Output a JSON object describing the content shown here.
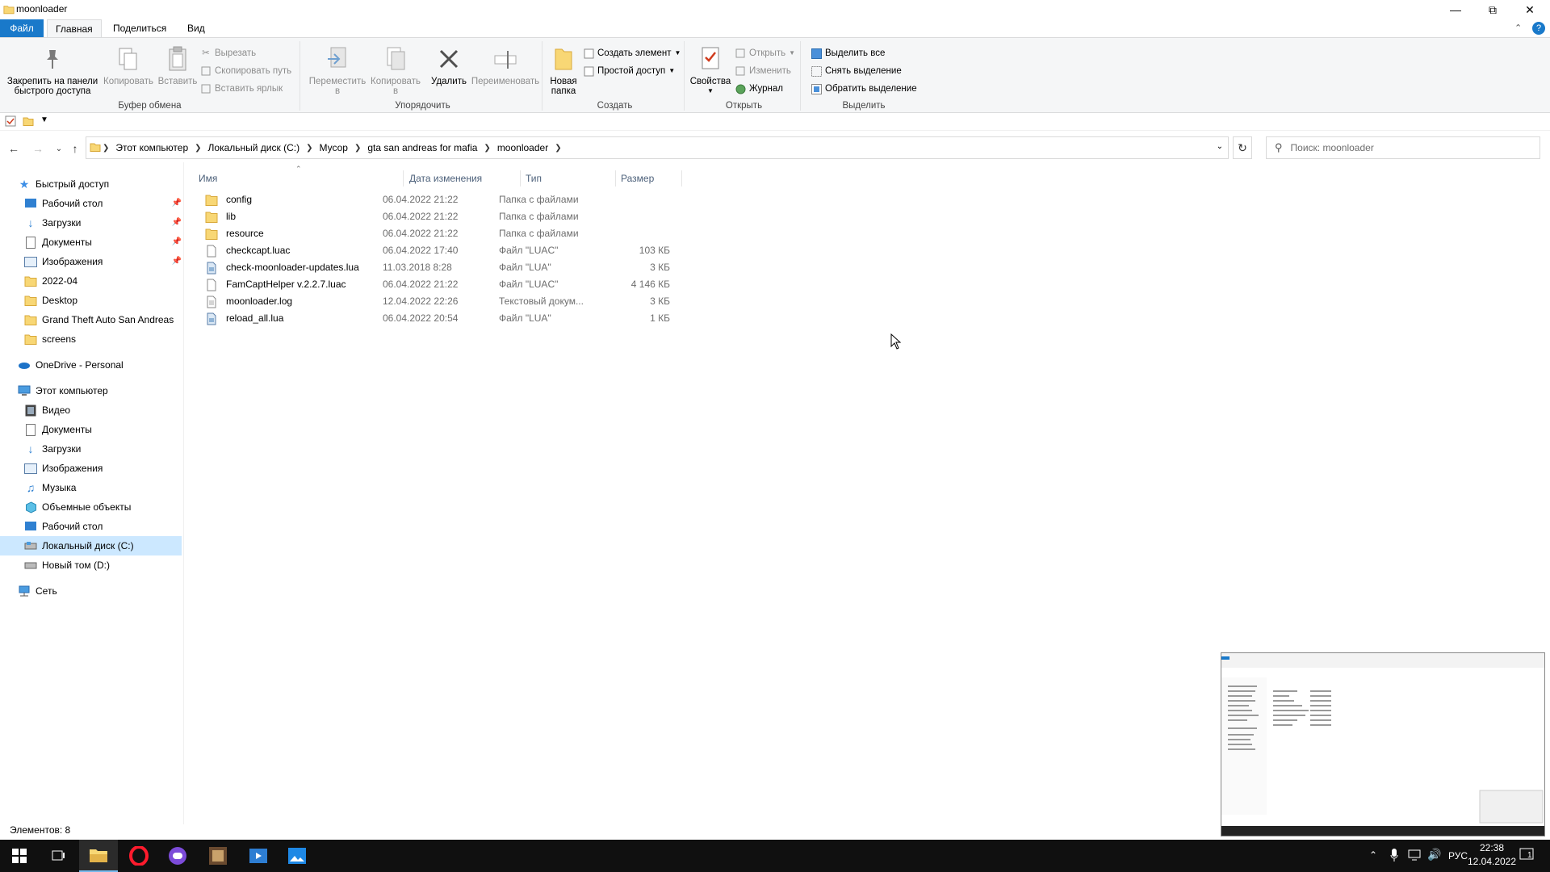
{
  "window": {
    "title": "moonloader"
  },
  "ribbon_tabs": [
    "Файл",
    "Главная",
    "Поделиться",
    "Вид"
  ],
  "clipboard": {
    "pin": "Закрепить на панели быстрого доступа",
    "pin_l1": "Закрепить на панели",
    "pin_l2": "быстрого доступа",
    "copy": "Копировать",
    "paste": "Вставить",
    "cut": "Вырезать",
    "copy_path": "Скопировать путь",
    "paste_shortcut": "Вставить ярлык",
    "label": "Буфер обмена"
  },
  "organize": {
    "move_l1": "Переместить",
    "move_l2": "в",
    "copyto_l1": "Копировать",
    "copyto_l2": "в",
    "delete": "Удалить",
    "rename": "Переименовать",
    "label": "Упорядочить"
  },
  "create": {
    "new_folder_l1": "Новая",
    "new_folder_l2": "папка",
    "new_item": "Создать элемент",
    "easy_access": "Простой доступ",
    "label": "Создать"
  },
  "open": {
    "properties": "Свойства",
    "open": "Открыть",
    "edit": "Изменить",
    "history": "Журнал",
    "label": "Открыть"
  },
  "select": {
    "select_all": "Выделить все",
    "select_none": "Снять выделение",
    "invert": "Обратить выделение",
    "label": "Выделить"
  },
  "breadcrumbs": [
    "Этот компьютер",
    "Локальный диск (C:)",
    "Мусор",
    "gta san andreas for mafia",
    "moonloader"
  ],
  "search": {
    "placeholder": "Поиск: moonloader"
  },
  "nav": {
    "quick_access": "Быстрый доступ",
    "quick_items": [
      "Рабочий стол",
      "Загрузки",
      "Документы",
      "Изображения",
      "2022-04",
      "Desktop",
      "Grand Theft Auto  San Andreas",
      "screens"
    ],
    "onedrive": "OneDrive - Personal",
    "this_pc": "Этот компьютер",
    "pc_items": [
      "Видео",
      "Документы",
      "Загрузки",
      "Изображения",
      "Музыка",
      "Объемные объекты",
      "Рабочий стол",
      "Локальный диск (C:)",
      "Новый том (D:)"
    ],
    "network": "Сеть"
  },
  "columns": {
    "name": "Имя",
    "date": "Дата изменения",
    "type": "Тип",
    "size": "Размер"
  },
  "files": [
    {
      "name": "config",
      "date": "06.04.2022 21:22",
      "type": "Папка с файлами",
      "size": "",
      "kind": "folder"
    },
    {
      "name": "lib",
      "date": "06.04.2022 21:22",
      "type": "Папка с файлами",
      "size": "",
      "kind": "folder"
    },
    {
      "name": "resource",
      "date": "06.04.2022 21:22",
      "type": "Папка с файлами",
      "size": "",
      "kind": "folder"
    },
    {
      "name": "checkcapt.luac",
      "date": "06.04.2022 17:40",
      "type": "Файл \"LUAC\"",
      "size": "103 КБ",
      "kind": "file"
    },
    {
      "name": "check-moonloader-updates.lua",
      "date": "11.03.2018 8:28",
      "type": "Файл \"LUA\"",
      "size": "3 КБ",
      "kind": "lua"
    },
    {
      "name": "FamCaptHelper v.2.2.7.luac",
      "date": "06.04.2022 21:22",
      "type": "Файл \"LUAC\"",
      "size": "4 146 КБ",
      "kind": "file"
    },
    {
      "name": "moonloader.log",
      "date": "12.04.2022 22:26",
      "type": "Текстовый докум...",
      "size": "3 КБ",
      "kind": "text"
    },
    {
      "name": "reload_all.lua",
      "date": "06.04.2022 20:54",
      "type": "Файл \"LUA\"",
      "size": "1 КБ",
      "kind": "lua"
    }
  ],
  "status": {
    "items": "Элементов: 8"
  },
  "taskbar": {
    "time": "22:38",
    "date": "12.04.2022",
    "lang": "РУС",
    "notifications": "1"
  },
  "colors": {
    "accent": "#1979ca",
    "folder": "#f8d775",
    "selection": "#cce8ff",
    "taskbar": "#101010"
  }
}
